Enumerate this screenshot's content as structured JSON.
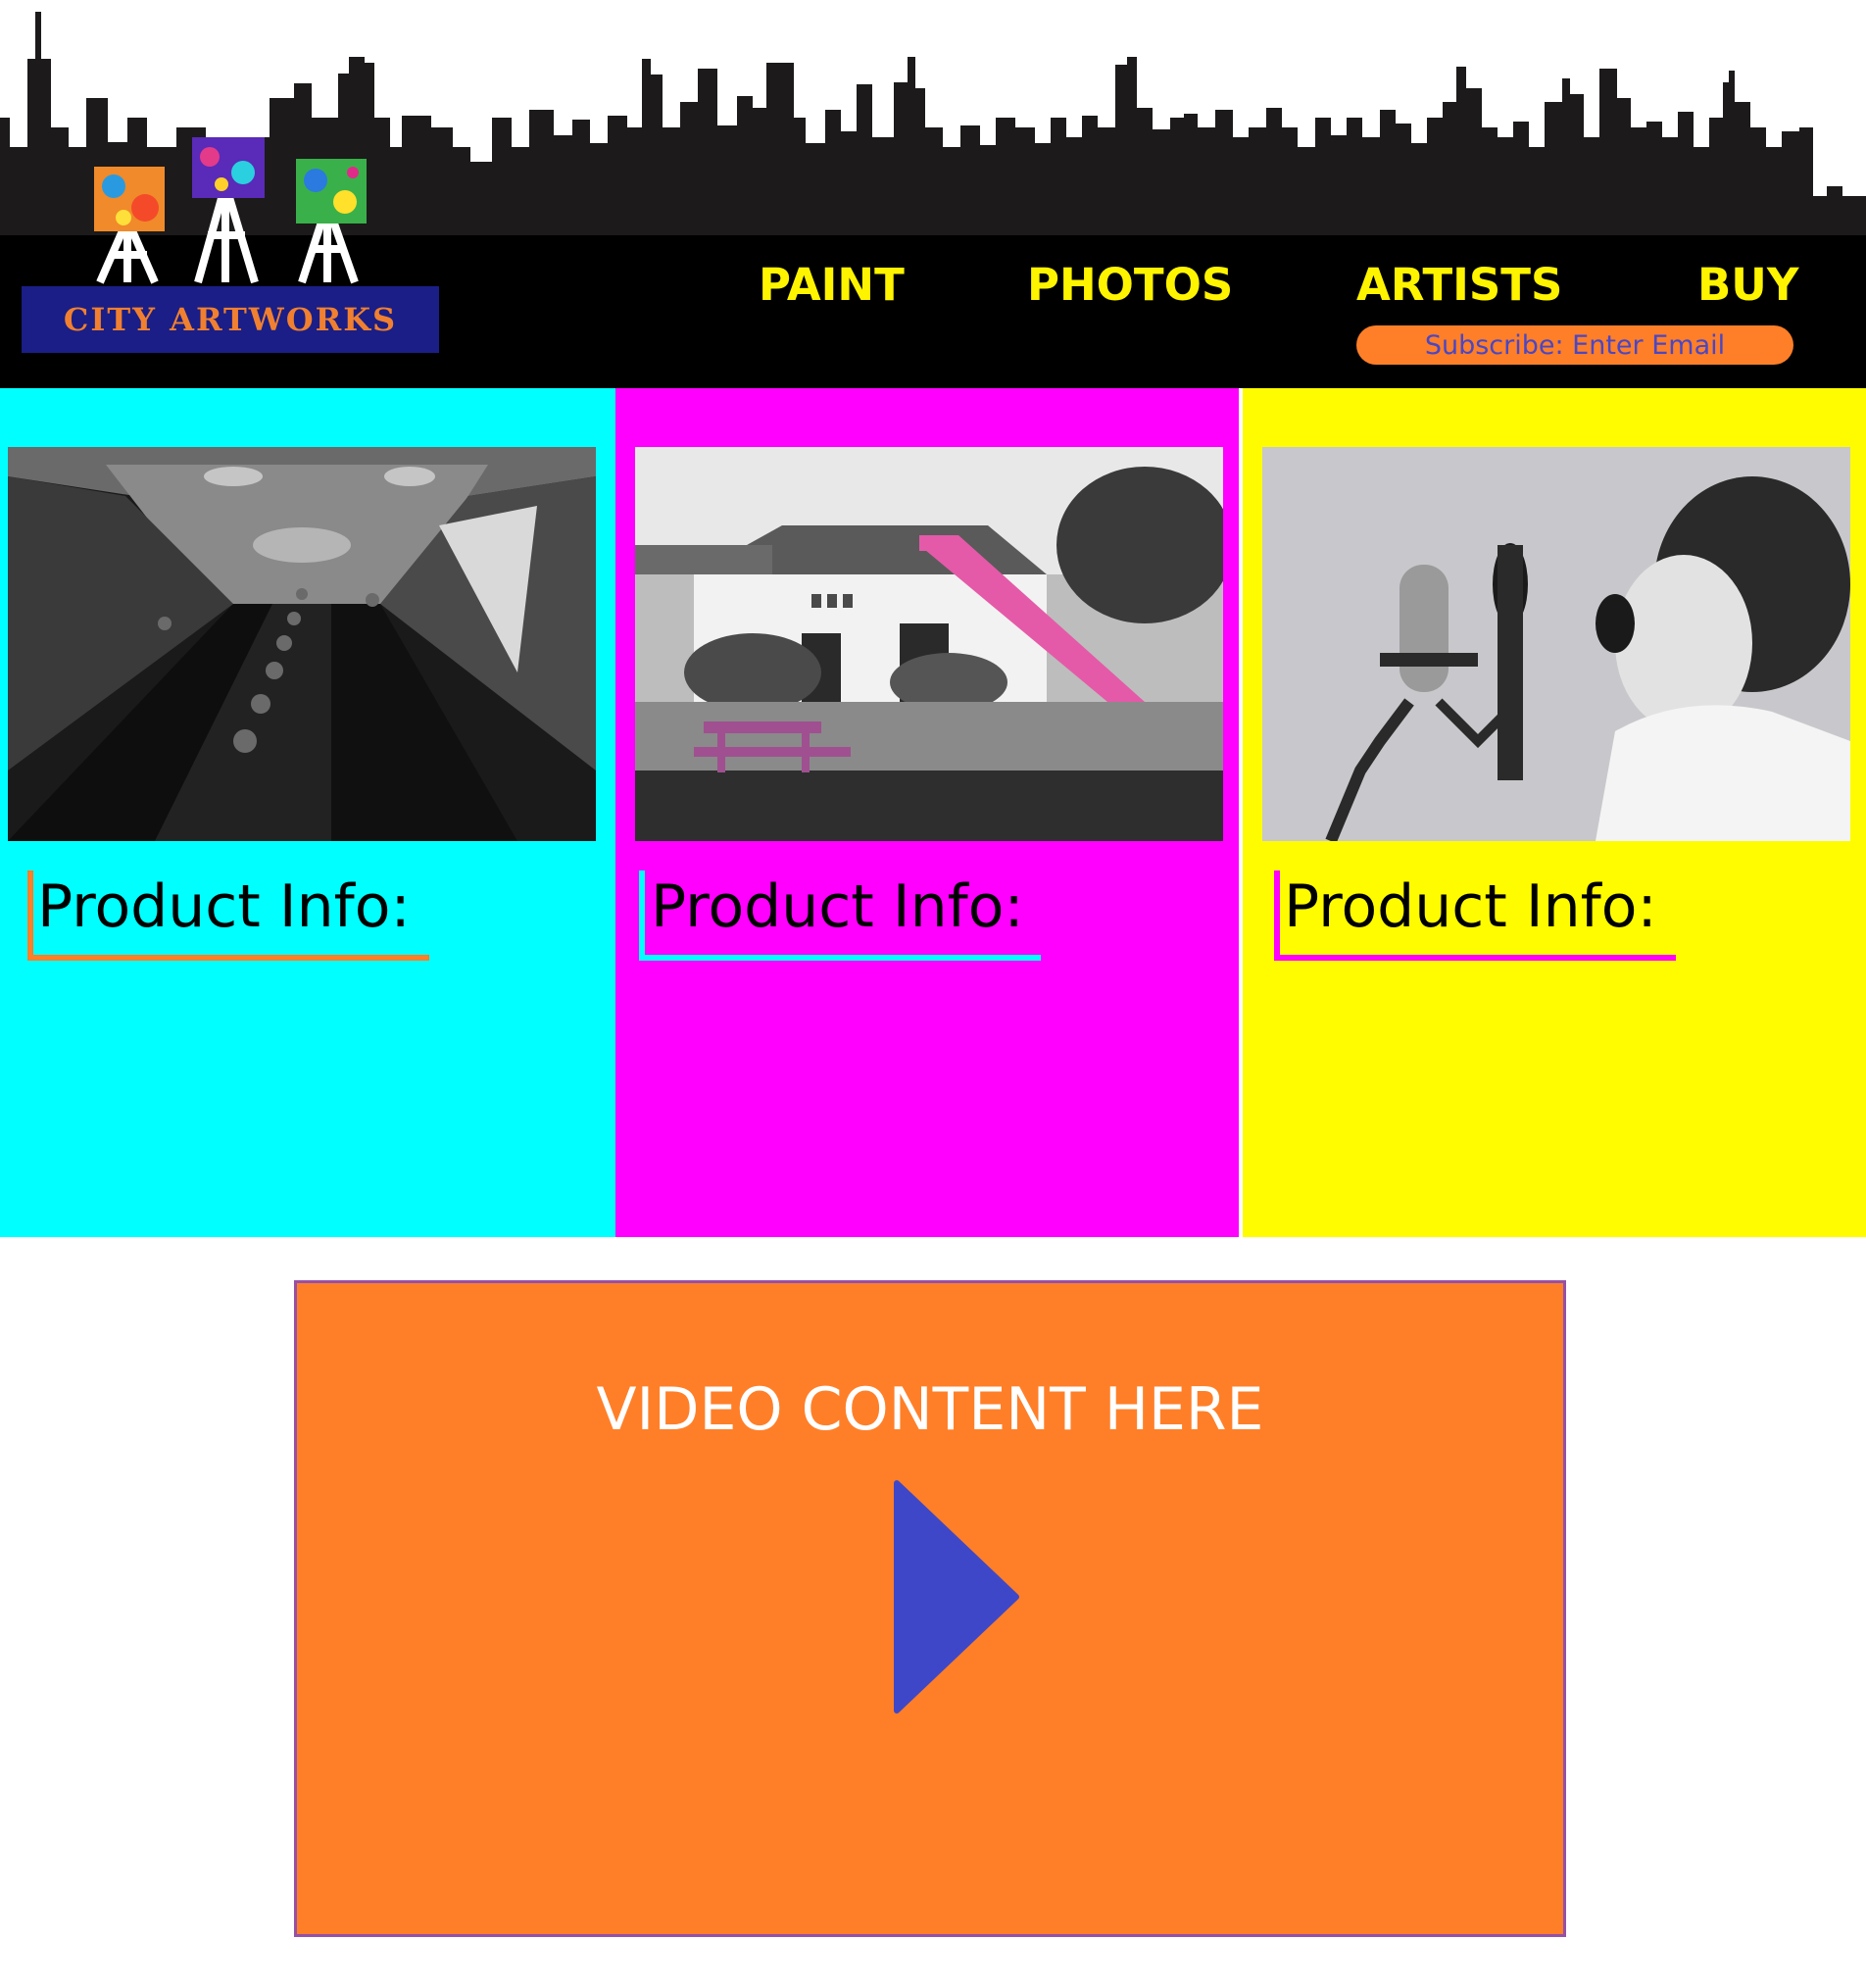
{
  "brand": {
    "name": "CITY ARTWORKS"
  },
  "nav": [
    "PAINT",
    "PHOTOS",
    "ARTISTS",
    "BUY"
  ],
  "subscribe": {
    "placeholder": "Subscribe: Enter Email"
  },
  "columns": [
    {
      "photo_subject": "escalator",
      "info_label": "Product Info:",
      "background": "#00ffff",
      "accent": "#ff7f28"
    },
    {
      "photo_subject": "house-with-pink-staircase",
      "info_label": "Product Info:",
      "background": "#ff00ff",
      "accent": "#00ffff"
    },
    {
      "photo_subject": "boy-shouting-into-microphone",
      "info_label": "Product Info:",
      "background": "#fffc00",
      "accent": "#ff00ff"
    }
  ],
  "video": {
    "label": "VIDEO CONTENT HERE",
    "icon": "play-icon"
  },
  "colors": {
    "header": "#000000",
    "nav_text": "#fff400",
    "video_bg": "#ff7f28",
    "play": "#3e47c8",
    "video_border": "#9650a6"
  }
}
